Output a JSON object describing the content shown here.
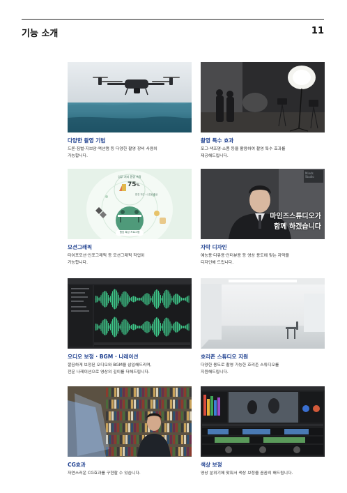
{
  "header": {
    "title": "기능 소개",
    "page_number": "11"
  },
  "cards": [
    {
      "title": "다양한 촬영 기법",
      "desc": [
        "드론·짐벌·지브암·액션캠 등 다양한 촬영 장비 사용이",
        "가능합니다."
      ],
      "image": "drone-over-sea-photo"
    },
    {
      "title": "촬영 특수 효과",
      "desc": [
        "포그·색조명·소품 등을 활용하여 촬영 특수 효과를",
        "제공해드립니다."
      ],
      "image": "studio-lighting-photo"
    },
    {
      "title": "모션그래픽",
      "desc": [
        "타이포모션·인포그래픽 등 모션그래픽 작업이",
        "가능합니다."
      ],
      "image": "motion-graphic-infographic",
      "graphic": {
        "top_label": "업무 처리 환경 측정",
        "value": "75",
        "unit": "%",
        "sub_label": "환경 개선 시 효율 향상",
        "bottom_label": "협업 특성 프로그램"
      }
    },
    {
      "title": "자막 디자인",
      "desc": [
        "예능용·다큐용·인터뷰용 등 영상 용도에 맞는 자막을",
        "디자인해 드립니다."
      ],
      "image": "presenter-subtitle-photo",
      "subtitle_lines": [
        "마인즈스튜디오가",
        "함께 하겠습니다"
      ],
      "corner_logo": [
        "Minds",
        "Studio"
      ]
    },
    {
      "title": "오디오 보정 · BGM · 나레이션",
      "desc": [
        "깔끔하게 보정된 오디오와 BGM을 삽입해드리며,",
        "전문 나레이션으로 영상의 깊이를 더해드립니다."
      ],
      "image": "audio-waveform-editor"
    },
    {
      "title": "호리존 스튜디오 지원",
      "desc": [
        "다양한 용도로 촬영 가능한 호리존 스튜디오를",
        "지원해드립니다."
      ],
      "image": "horizon-studio-photo"
    },
    {
      "title": "CG효과",
      "desc": [
        "자연스러운 CG효과를 구현할 수 있습니다."
      ],
      "image": "library-cg-photo"
    },
    {
      "title": "색상 보정",
      "desc": [
        "영상 분위기에 맞춰서 색상 보정을 꼼꼼히 해드립니다."
      ],
      "image": "color-grading-software"
    }
  ]
}
